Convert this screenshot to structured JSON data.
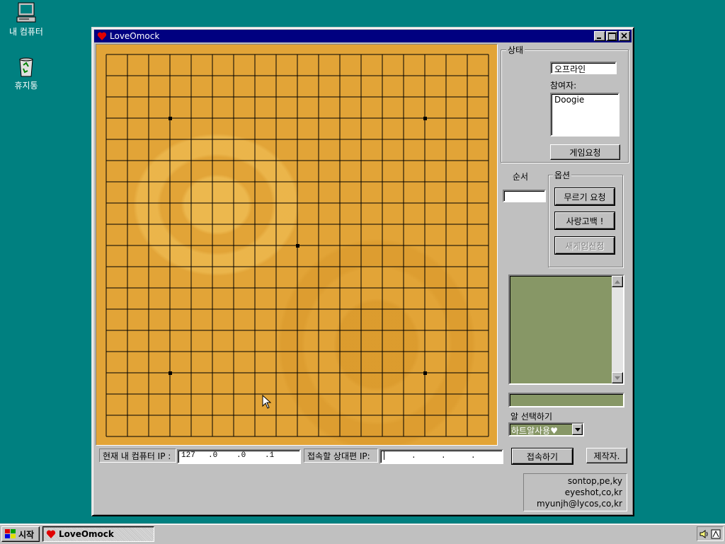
{
  "desktop": {
    "icons": [
      {
        "label": "내 컴퓨터"
      },
      {
        "label": "휴지통"
      }
    ]
  },
  "window": {
    "title": "LoveOmock",
    "board": {
      "lines": 19,
      "star_points": [
        [
          3,
          3
        ],
        [
          3,
          15
        ],
        [
          9,
          9
        ],
        [
          15,
          3
        ],
        [
          15,
          15
        ]
      ]
    },
    "status": {
      "group_label": "상태",
      "connection": "오프라인",
      "participants_label": "참여자:",
      "participants": [
        "Doogie"
      ],
      "game_request_button": "게임요청"
    },
    "turn_label": "순서",
    "turn_value": "",
    "options": {
      "group_label": "옵션",
      "undo_button": "무르기 요청",
      "love_button": "사랑고백 !",
      "new_game_button": "새게임신청"
    },
    "stone_select": {
      "label": "알 선택하기",
      "value": "하트알사용♥"
    },
    "connection_bar": {
      "my_ip_label": "현재 내 컴퓨터 IP :",
      "my_ip": [
        "127",
        ".0",
        ".0",
        ".1"
      ],
      "peer_ip_label": "접속할 상대편 IP:",
      "peer_ip": [
        "",
        ".",
        ".",
        "."
      ],
      "connect_button": "접속하기",
      "credits_button": "제작자."
    },
    "credits": [
      "sontop,pe,ky",
      "eyeshot,co,kr",
      "myunjh@lycos,co,kr"
    ]
  },
  "taskbar": {
    "start_label": "시작",
    "task_label": "LoveOmock"
  },
  "colors": {
    "desktop": "#008080",
    "title_bar": "#000080",
    "board": "#e2a437",
    "chat": "#879766"
  }
}
